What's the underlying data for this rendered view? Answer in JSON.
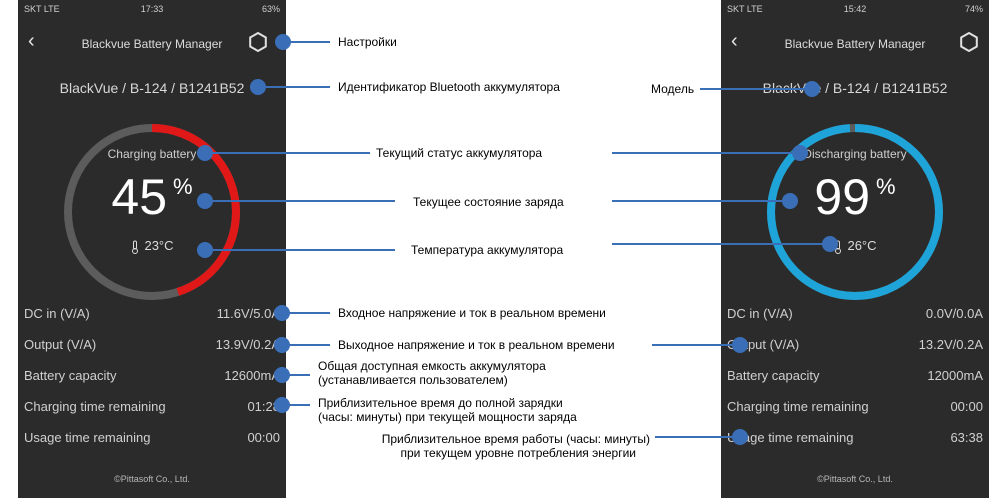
{
  "colors": {
    "phone_bg": "#2b2b2b",
    "charging_arc": "#e01818",
    "charging_track": "#5c5c5c",
    "discharging_arc": "#1ea4d8",
    "callout": "#3a6fb8",
    "annotation_text": "#000000"
  },
  "left_phone": {
    "status_bar": {
      "left": "SKT LTE",
      "time": "17:33",
      "right": "63%"
    },
    "back_icon": "back-chevron-icon",
    "title": "Blackvue Battery Manager",
    "settings_icon": "gear-icon",
    "model": "BlackVue / B-124  / B1241B52",
    "battery_status": "Charging battery",
    "percent": "45",
    "percent_sign": "%",
    "charge_level": 0.45,
    "temperature": "23°C",
    "rows": [
      {
        "label": "DC in (V/A)",
        "value": "11.6V/5.0A"
      },
      {
        "label": "Output (V/A)",
        "value": "13.9V/0.2A"
      },
      {
        "label": "Battery capacity",
        "value": "12600mA"
      },
      {
        "label": "Charging time remaining",
        "value": "01:28"
      },
      {
        "label": "Usage time remaining",
        "value": "00:00"
      }
    ],
    "footer": "©Pittasoft Co., Ltd."
  },
  "right_phone": {
    "status_bar": {
      "left": "SKT LTE",
      "time": "15:42",
      "right": "74%"
    },
    "back_icon": "back-chevron-icon",
    "title": "Blackvue Battery Manager",
    "settings_icon": "gear-icon",
    "model": "BlackVue / B-124  / B1241B52",
    "battery_status": "Discharging battery",
    "percent": "99",
    "percent_sign": "%",
    "charge_level": 0.99,
    "temperature": "26°C",
    "rows": [
      {
        "label": "DC in (V/A)",
        "value": "0.0V/0.0A"
      },
      {
        "label": "Output (V/A)",
        "value": "13.2V/0.2A"
      },
      {
        "label": "Battery capacity",
        "value": "12000mA"
      },
      {
        "label": "Charging time remaining",
        "value": "00:00"
      },
      {
        "label": "Usage time remaining",
        "value": "63:38"
      }
    ],
    "footer": "©Pittasoft Co., Ltd."
  },
  "annotations": {
    "settings": "Настройки",
    "bluetooth_id": "Идентификатор Bluetooth аккумулятора",
    "model": "Модель",
    "status": "Текущий статус аккумулятора",
    "charge": "Текущее состояние заряда",
    "temperature": "Температура аккумулятора",
    "dc_in": "Входное напряжение и ток в реальном времени",
    "output": "Выходное напряжение и ток в реальном времени",
    "capacity_1": "Общая доступная емкость аккумулятора",
    "capacity_2": "(устанавливается пользователем)",
    "charging_time_1": "Приблизительное время до полной зарядки",
    "charging_time_2": "(часы: минуты) при текущей мощности заряда",
    "usage_time_1": "Приблизительное время работы (часы: минуты)",
    "usage_time_2": "при текущем уровне потребления энергии"
  }
}
